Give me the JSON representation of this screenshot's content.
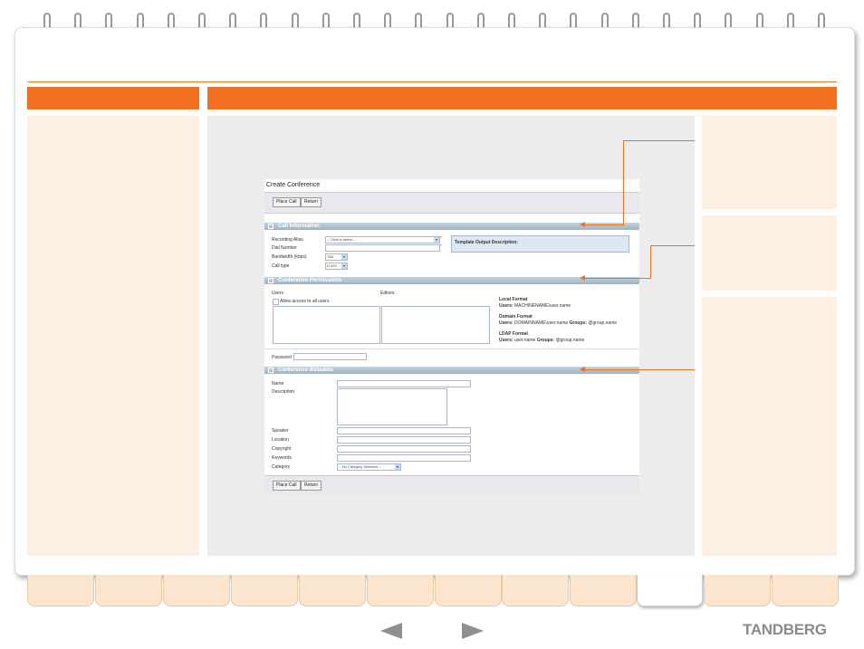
{
  "colors": {
    "accent": "#f37021",
    "panel": "#fdf0e2",
    "stage": "#ececec"
  },
  "app": {
    "title": "Create Conference",
    "buttons": {
      "place_call": "Place Call",
      "return": "Return"
    },
    "call_info": {
      "heading": "Call Information",
      "recording_alias_label": "Recording Alias",
      "recording_alias_value": "-- Click to select --",
      "dial_number_label": "Dial Number",
      "bandwidth_label": "Bandwidth (kbps)",
      "bandwidth_value": "768",
      "call_type_label": "Call type",
      "call_type_value": "H.323",
      "template_desc": "Template Output Description:"
    },
    "permissions": {
      "heading": "Conference Permissions",
      "users_label": "Users",
      "editors_label": "Editors",
      "allow_all": "Allow access to all users",
      "local_title": "Local Format",
      "local_users_label": "Users:",
      "local_users_value": "MACHINENAME\\user.name",
      "domain_title": "Domain Format",
      "domain_users_label": "Users:",
      "domain_users_value": "DOMAINNAME\\user.name",
      "domain_groups_label": "Groups:",
      "domain_groups_value": "@group.name",
      "ldap_title": "LDAP Format",
      "ldap_users_label": "Users:",
      "ldap_users_value": "user.name",
      "ldap_groups_label": "Groups:",
      "ldap_groups_value": "@group.name",
      "password_label": "Password"
    },
    "metadata": {
      "heading": "Conference Metadata",
      "name_label": "Name",
      "description_label": "Description",
      "speaker_label": "Speaker",
      "location_label": "Location",
      "copyright_label": "Copyright",
      "keywords_label": "Keywords",
      "category_label": "Category",
      "category_value": "-- No Category Selected --"
    }
  },
  "logo": "TANDBERG"
}
